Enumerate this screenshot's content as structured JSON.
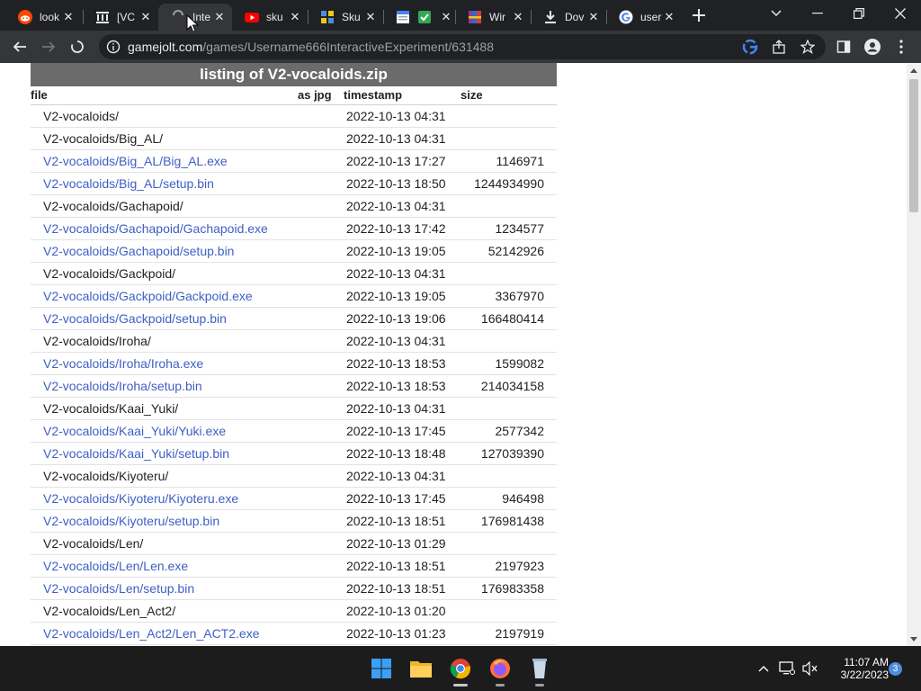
{
  "tabs": [
    {
      "title": "look",
      "icon": "reddit-icon",
      "active": false
    },
    {
      "title": "[VC",
      "icon": "archive-icon",
      "active": false
    },
    {
      "title": "Inte",
      "icon": "gamejolt-icon",
      "active": true
    },
    {
      "title": "sku",
      "icon": "youtube-icon",
      "active": false
    },
    {
      "title": "Sku",
      "icon": "wiki-icon",
      "active": false
    },
    {
      "title": "",
      "icon": "docs-icon",
      "active": false
    },
    {
      "title": "Wir",
      "icon": "winrar-icon",
      "active": false
    },
    {
      "title": "Dov",
      "icon": "download-icon",
      "active": false
    },
    {
      "title": "usernan",
      "icon": "google-icon",
      "active": false
    }
  ],
  "toolbar": {
    "url_domain": "gamejolt.com",
    "url_path": "/games/Username666InteractiveExperiment/631488"
  },
  "listing": {
    "title": "listing of V2-vocaloids.zip",
    "col_file": "file",
    "col_as": "as jpg",
    "col_timestamp": "timestamp",
    "col_size": "size",
    "rows": [
      {
        "name": "V2-vocaloids/",
        "timestamp": "2022-10-13 04:31",
        "size": "",
        "link": false
      },
      {
        "name": "V2-vocaloids/Big_AL/",
        "timestamp": "2022-10-13 04:31",
        "size": "",
        "link": false
      },
      {
        "name": "V2-vocaloids/Big_AL/Big_AL.exe",
        "timestamp": "2022-10-13 17:27",
        "size": "1146971",
        "link": true
      },
      {
        "name": "V2-vocaloids/Big_AL/setup.bin",
        "timestamp": "2022-10-13 18:50",
        "size": "1244934990",
        "link": true
      },
      {
        "name": "V2-vocaloids/Gachapoid/",
        "timestamp": "2022-10-13 04:31",
        "size": "",
        "link": false
      },
      {
        "name": "V2-vocaloids/Gachapoid/Gachapoid.exe",
        "timestamp": "2022-10-13 17:42",
        "size": "1234577",
        "link": true
      },
      {
        "name": "V2-vocaloids/Gachapoid/setup.bin",
        "timestamp": "2022-10-13 19:05",
        "size": "52142926",
        "link": true
      },
      {
        "name": "V2-vocaloids/Gackpoid/",
        "timestamp": "2022-10-13 04:31",
        "size": "",
        "link": false
      },
      {
        "name": "V2-vocaloids/Gackpoid/Gackpoid.exe",
        "timestamp": "2022-10-13 19:05",
        "size": "3367970",
        "link": true
      },
      {
        "name": "V2-vocaloids/Gackpoid/setup.bin",
        "timestamp": "2022-10-13 19:06",
        "size": "166480414",
        "link": true
      },
      {
        "name": "V2-vocaloids/Iroha/",
        "timestamp": "2022-10-13 04:31",
        "size": "",
        "link": false
      },
      {
        "name": "V2-vocaloids/Iroha/Iroha.exe",
        "timestamp": "2022-10-13 18:53",
        "size": "1599082",
        "link": true
      },
      {
        "name": "V2-vocaloids/Iroha/setup.bin",
        "timestamp": "2022-10-13 18:53",
        "size": "214034158",
        "link": true
      },
      {
        "name": "V2-vocaloids/Kaai_Yuki/",
        "timestamp": "2022-10-13 04:31",
        "size": "",
        "link": false
      },
      {
        "name": "V2-vocaloids/Kaai_Yuki/Yuki.exe",
        "timestamp": "2022-10-13 17:45",
        "size": "2577342",
        "link": true
      },
      {
        "name": "V2-vocaloids/Kaai_Yuki/setup.bin",
        "timestamp": "2022-10-13 18:48",
        "size": "127039390",
        "link": true
      },
      {
        "name": "V2-vocaloids/Kiyoteru/",
        "timestamp": "2022-10-13 04:31",
        "size": "",
        "link": false
      },
      {
        "name": "V2-vocaloids/Kiyoteru/Kiyoteru.exe",
        "timestamp": "2022-10-13 17:45",
        "size": "946498",
        "link": true
      },
      {
        "name": "V2-vocaloids/Kiyoteru/setup.bin",
        "timestamp": "2022-10-13 18:51",
        "size": "176981438",
        "link": true
      },
      {
        "name": "V2-vocaloids/Len/",
        "timestamp": "2022-10-13 01:29",
        "size": "",
        "link": false
      },
      {
        "name": "V2-vocaloids/Len/Len.exe",
        "timestamp": "2022-10-13 18:51",
        "size": "2197923",
        "link": true
      },
      {
        "name": "V2-vocaloids/Len/setup.bin",
        "timestamp": "2022-10-13 18:51",
        "size": "176983358",
        "link": true
      },
      {
        "name": "V2-vocaloids/Len_Act2/",
        "timestamp": "2022-10-13 01:20",
        "size": "",
        "link": false
      },
      {
        "name": "V2-vocaloids/Len_Act2/Len_ACT2.exe",
        "timestamp": "2022-10-13 01:23",
        "size": "2197919",
        "link": true
      }
    ]
  },
  "taskbar": {
    "time": "11:07 AM",
    "date": "3/22/2023",
    "notifications": "3"
  },
  "colors": {
    "link": "#3e5fc4",
    "title_bar": "#6b6b6b",
    "chrome_dark": "#202124",
    "chrome_toolbar": "#35363a"
  }
}
